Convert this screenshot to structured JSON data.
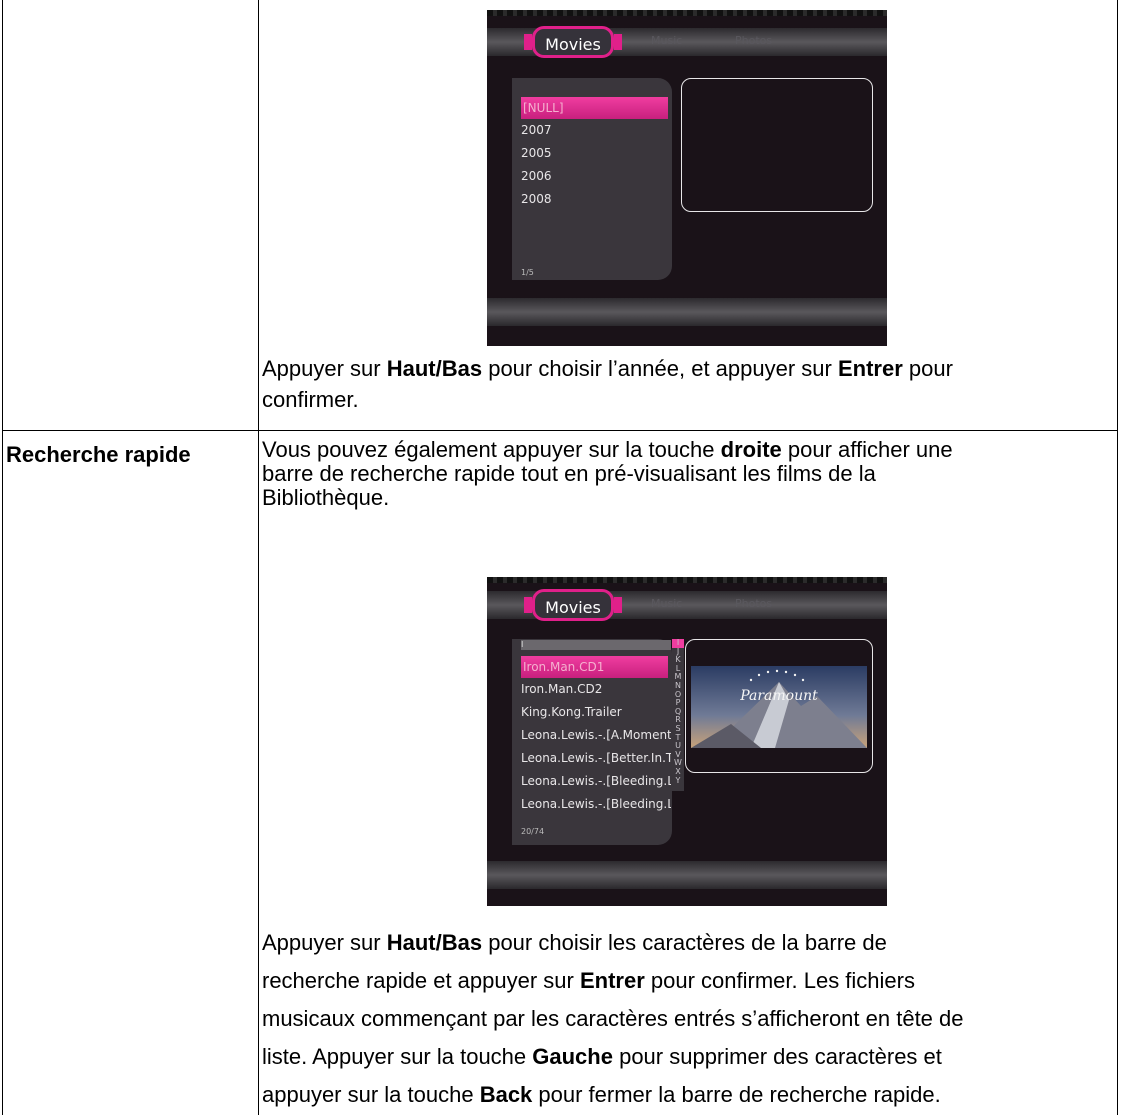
{
  "row1": {
    "screenshot": {
      "tabs": [
        "Movies",
        "Music",
        "Photos"
      ],
      "list_items": [
        "[NULL]",
        "2007",
        "2005",
        "2006",
        "2008"
      ],
      "selected_index": 0,
      "counter": "1/5"
    },
    "text_parts": [
      "Appuyer sur ",
      "Haut/Bas",
      " pour choisir l’année, et appuyer sur ",
      "Entrer",
      " pour",
      "confirmer."
    ]
  },
  "row2": {
    "label": "Recherche rapide",
    "intro_parts": [
      "Vous pouvez également appuyer sur la touche ",
      "droite",
      " pour afficher une",
      "barre de recherche rapide tout en pré-visualisant les films de la",
      "Bibliothèque."
    ],
    "screenshot": {
      "tabs": [
        "Movies",
        "Music",
        "Photos"
      ],
      "search_value": "I",
      "list_items": [
        "Iron.Man.CD1",
        "Iron.Man.CD2",
        "King.Kong.Trailer",
        "Leona.Lewis.-.[A.Moment",
        "Leona.Lewis.-.[Better.In.T",
        "Leona.Lewis.-.[Bleeding.L",
        "Leona.Lewis.-.[Bleeding.Lo"
      ],
      "selected_index": 0,
      "counter": "20/74",
      "alphabet": [
        "I",
        "J",
        "K",
        "L",
        "M",
        "N",
        "O",
        "P",
        "Q",
        "R",
        "S",
        "T",
        "U",
        "V",
        "W",
        "X",
        "Y"
      ],
      "preview_logo": "Paramount"
    },
    "text_parts": [
      "Appuyer sur ",
      "Haut/Bas",
      " pour choisir les caractères de la barre de",
      "recherche rapide et appuyer sur ",
      "Entrer",
      " pour confirmer. Les fichiers",
      "musicaux commençant par les caractères entrés s’afficheront en tête de",
      "liste. Appuyer sur la touche ",
      "Gauche",
      " pour supprimer des caractères et",
      "appuyer sur la touche ",
      "Back",
      " pour fermer la barre de recherche rapide."
    ]
  }
}
